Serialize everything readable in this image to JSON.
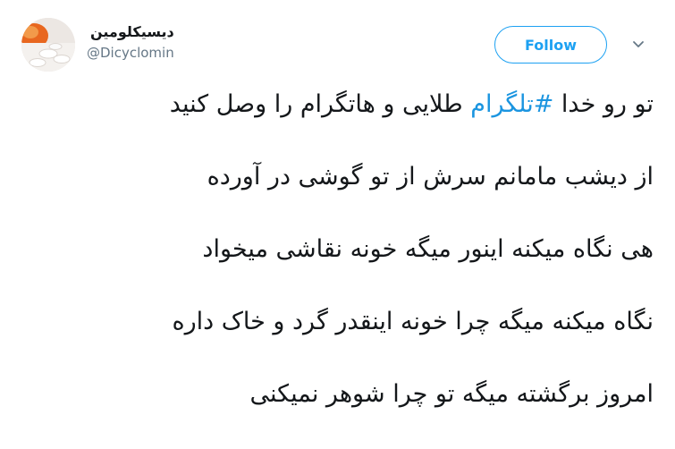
{
  "author": {
    "display_name": "دیسیکلومین",
    "handle": "@Dicyclomin",
    "avatar_icon": "pills-avatar"
  },
  "follow_button": {
    "label": "Follow",
    "color": "#1da1f2"
  },
  "menu": {
    "icon": "chevron-down-icon"
  },
  "tweet": {
    "line1": {
      "before": "تو رو خدا ",
      "hashtag": "#تلگرام",
      "after": " طلایی و هاتگرام را وصل کنید"
    },
    "line2": "از  دیشب مامانم سرش از تو گوشی در آورده",
    "line3": "هی نگاه میکنه اینور میگه خونه نقاشی میخواد",
    "line4": "نگاه میکنه میگه چرا خونه اینقدر گرد و خاک داره",
    "line5": "امروز برگشته میگه تو چرا شوهر نمیکنی"
  },
  "colors": {
    "text": "#14171a",
    "secondary": "#657786",
    "hashtag": "#1b95e0"
  }
}
